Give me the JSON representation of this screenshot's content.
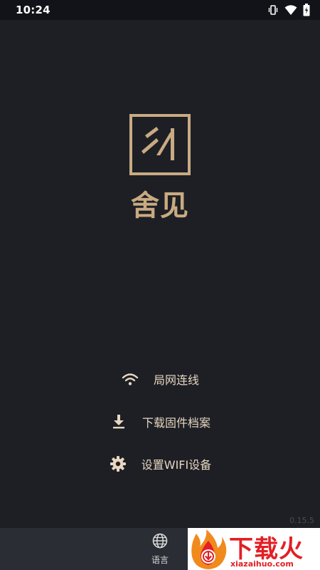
{
  "status_bar": {
    "time": "10:24",
    "icons": [
      "vibrate-icon",
      "wifi-icon",
      "battery-charging-icon"
    ]
  },
  "brand": {
    "name": "舍见",
    "accent_color": "#c9aa82"
  },
  "menu": {
    "items": [
      {
        "label": "局网连线",
        "icon": "wifi-icon"
      },
      {
        "label": "下载固件档案",
        "icon": "download-icon"
      },
      {
        "label": "设置WIFI设备",
        "icon": "gear-icon"
      }
    ]
  },
  "version": "0.15.5",
  "bottom_nav": {
    "language_label": "语言",
    "language_icon": "globe-icon"
  },
  "watermark": {
    "text": "下载火",
    "url": "xiazaihuo.com",
    "color": "#e31e24"
  },
  "colors": {
    "background": "#1d1f25",
    "menu_text": "#e8d7bf",
    "bottom_bar": "#2a2d33"
  }
}
